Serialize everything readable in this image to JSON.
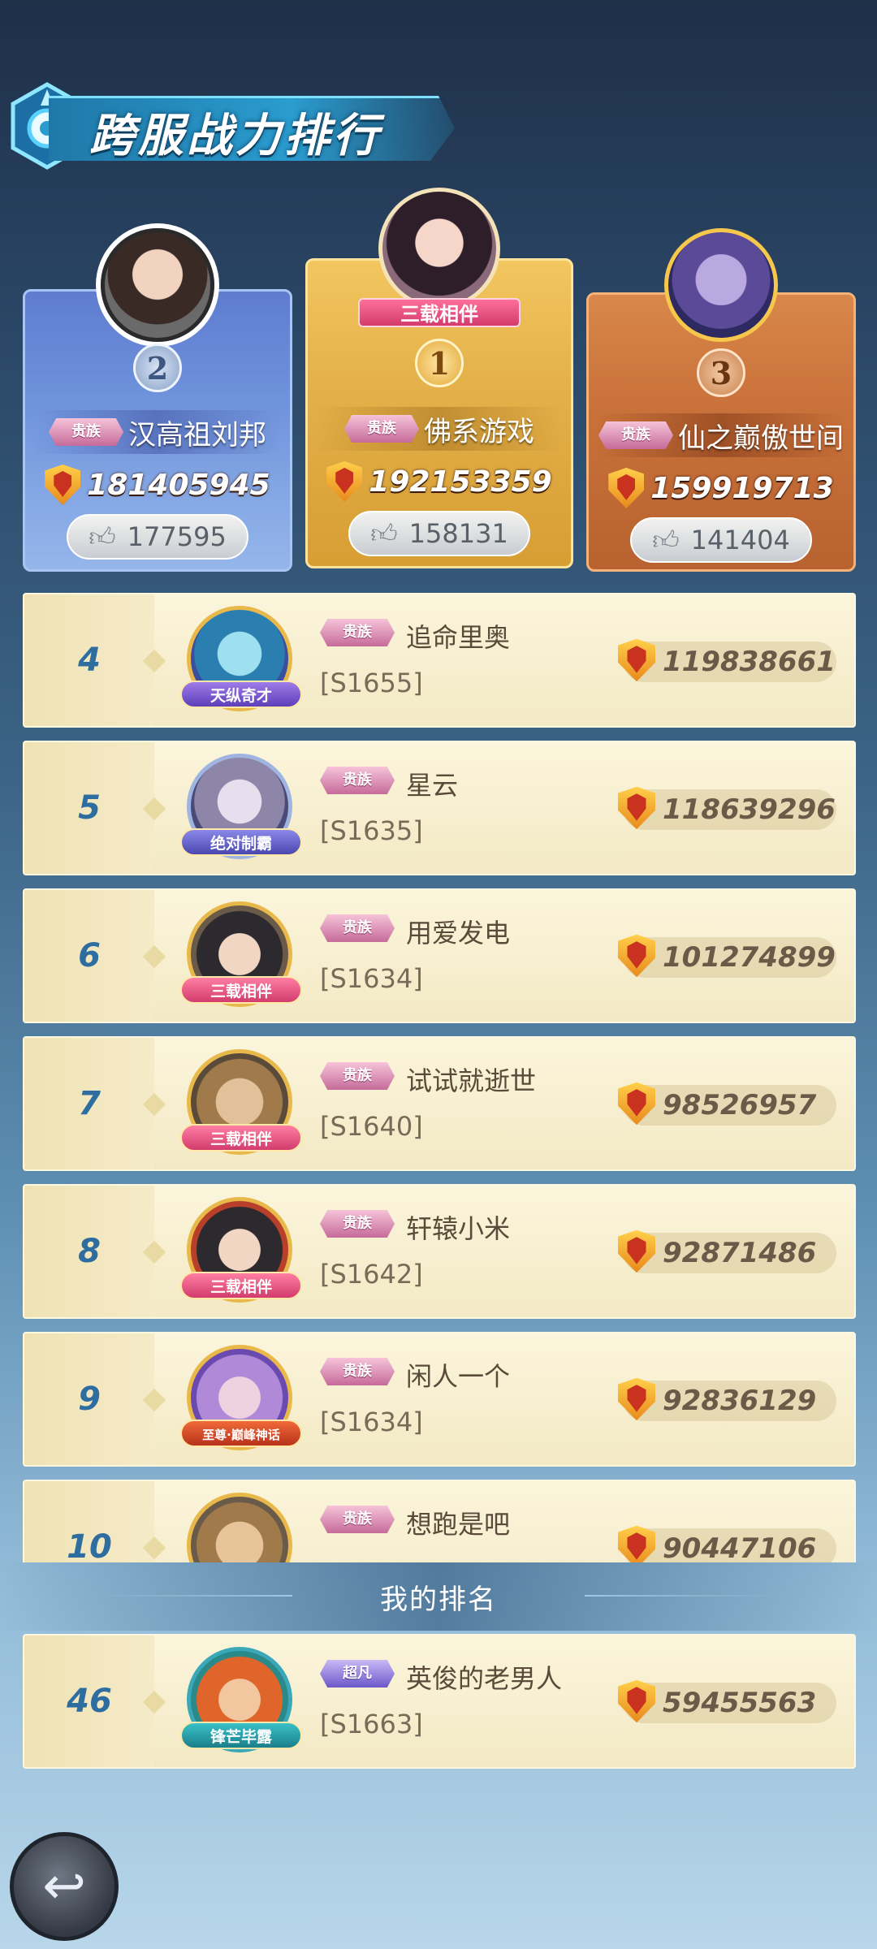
{
  "title": "跨服战力排行",
  "podium": [
    {
      "rank": "2",
      "name": "汉高祖刘邦",
      "vip": "贵族",
      "power": "181405945",
      "likes": "177595"
    },
    {
      "rank": "1",
      "name": "佛系游戏",
      "vip": "贵族",
      "power": "192153359",
      "likes": "158131",
      "frame_tag": "三载相伴"
    },
    {
      "rank": "3",
      "name": "仙之巅傲世间",
      "vip": "贵族",
      "power": "159919713",
      "likes": "141404"
    }
  ],
  "list": [
    {
      "rank": "4",
      "name": "追命里奥",
      "server": "[S1655]",
      "power": "119838661",
      "vip": "贵族",
      "tag": "天纵奇才"
    },
    {
      "rank": "5",
      "name": "星云",
      "server": "[S1635]",
      "power": "118639296",
      "vip": "贵族",
      "tag": "绝对制霸"
    },
    {
      "rank": "6",
      "name": "用爱发电",
      "server": "[S1634]",
      "power": "101274899",
      "vip": "贵族",
      "tag": "三载相伴"
    },
    {
      "rank": "7",
      "name": "试试就逝世",
      "server": "[S1640]",
      "power": "98526957",
      "vip": "贵族",
      "tag": "三载相伴"
    },
    {
      "rank": "8",
      "name": "轩辕小米",
      "server": "[S1642]",
      "power": "92871486",
      "vip": "贵族",
      "tag": "三载相伴"
    },
    {
      "rank": "9",
      "name": "闲人一个",
      "server": "[S1634]",
      "power": "92836129",
      "vip": "贵族",
      "tag": "至尊·巅峰神话"
    },
    {
      "rank": "10",
      "name": "想跑是吧",
      "server": "",
      "power": "90447106",
      "vip": "贵族",
      "tag": ""
    }
  ],
  "my_rank": {
    "header": "我的排名",
    "rank": "46",
    "name": "英俊的老男人",
    "server": "[S1663]",
    "power": "59455563",
    "vip": "超凡",
    "tag": "锋芒毕露"
  },
  "colors": {
    "rank_number": "#2d6da0",
    "second_place": "#6f93dc",
    "first_place": "#e4b14a",
    "third_place": "#c9723a"
  },
  "icons": {
    "power": "shield-icon",
    "likes": "thumbs-up-icon",
    "back": "back-arrow-icon"
  }
}
